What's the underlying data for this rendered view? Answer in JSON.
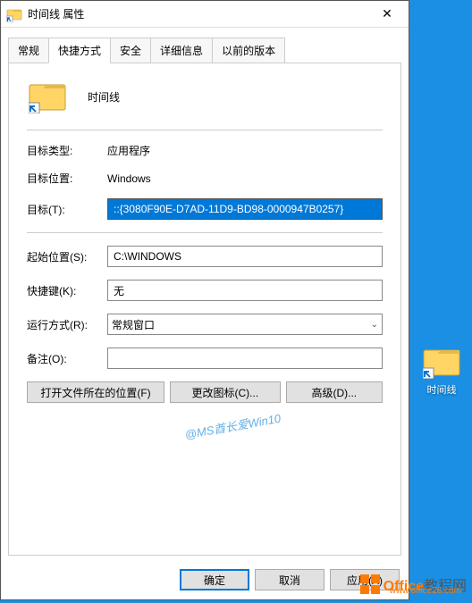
{
  "colors": {
    "desktop": "#1a8fe3",
    "accent": "#0078d7",
    "selection": "#0078d7",
    "brand": "#ff7a00"
  },
  "desktop": {
    "icon_label": "时间线"
  },
  "dialog": {
    "title": "时间线 属性",
    "tabs": [
      "常规",
      "快捷方式",
      "安全",
      "详细信息",
      "以前的版本"
    ],
    "active_tab": 1,
    "item_name": "时间线",
    "fields": {
      "target_type": {
        "label": "目标类型:",
        "value": "应用程序"
      },
      "target_location": {
        "label": "目标位置:",
        "value": "Windows"
      },
      "target": {
        "label": "目标(T):",
        "value": "::{3080F90E-D7AD-11D9-BD98-0000947B0257}"
      },
      "start_in": {
        "label": "起始位置(S):",
        "value": "C:\\WINDOWS"
      },
      "shortcut_key": {
        "label": "快捷键(K):",
        "value": "无"
      },
      "run": {
        "label": "运行方式(R):",
        "value": "常规窗口"
      },
      "comment": {
        "label": "备注(O):",
        "value": ""
      }
    },
    "buttons": {
      "open_file_location": "打开文件所在的位置(F)",
      "change_icon": "更改图标(C)...",
      "advanced": "高级(D)..."
    },
    "bottom": {
      "ok": "确定",
      "cancel": "取消",
      "apply": "应用(A)"
    }
  },
  "watermark": "@MS酋长爱Win10",
  "brand": {
    "name1": "Office",
    "name2": "教程网",
    "url": "www.office26.com"
  }
}
